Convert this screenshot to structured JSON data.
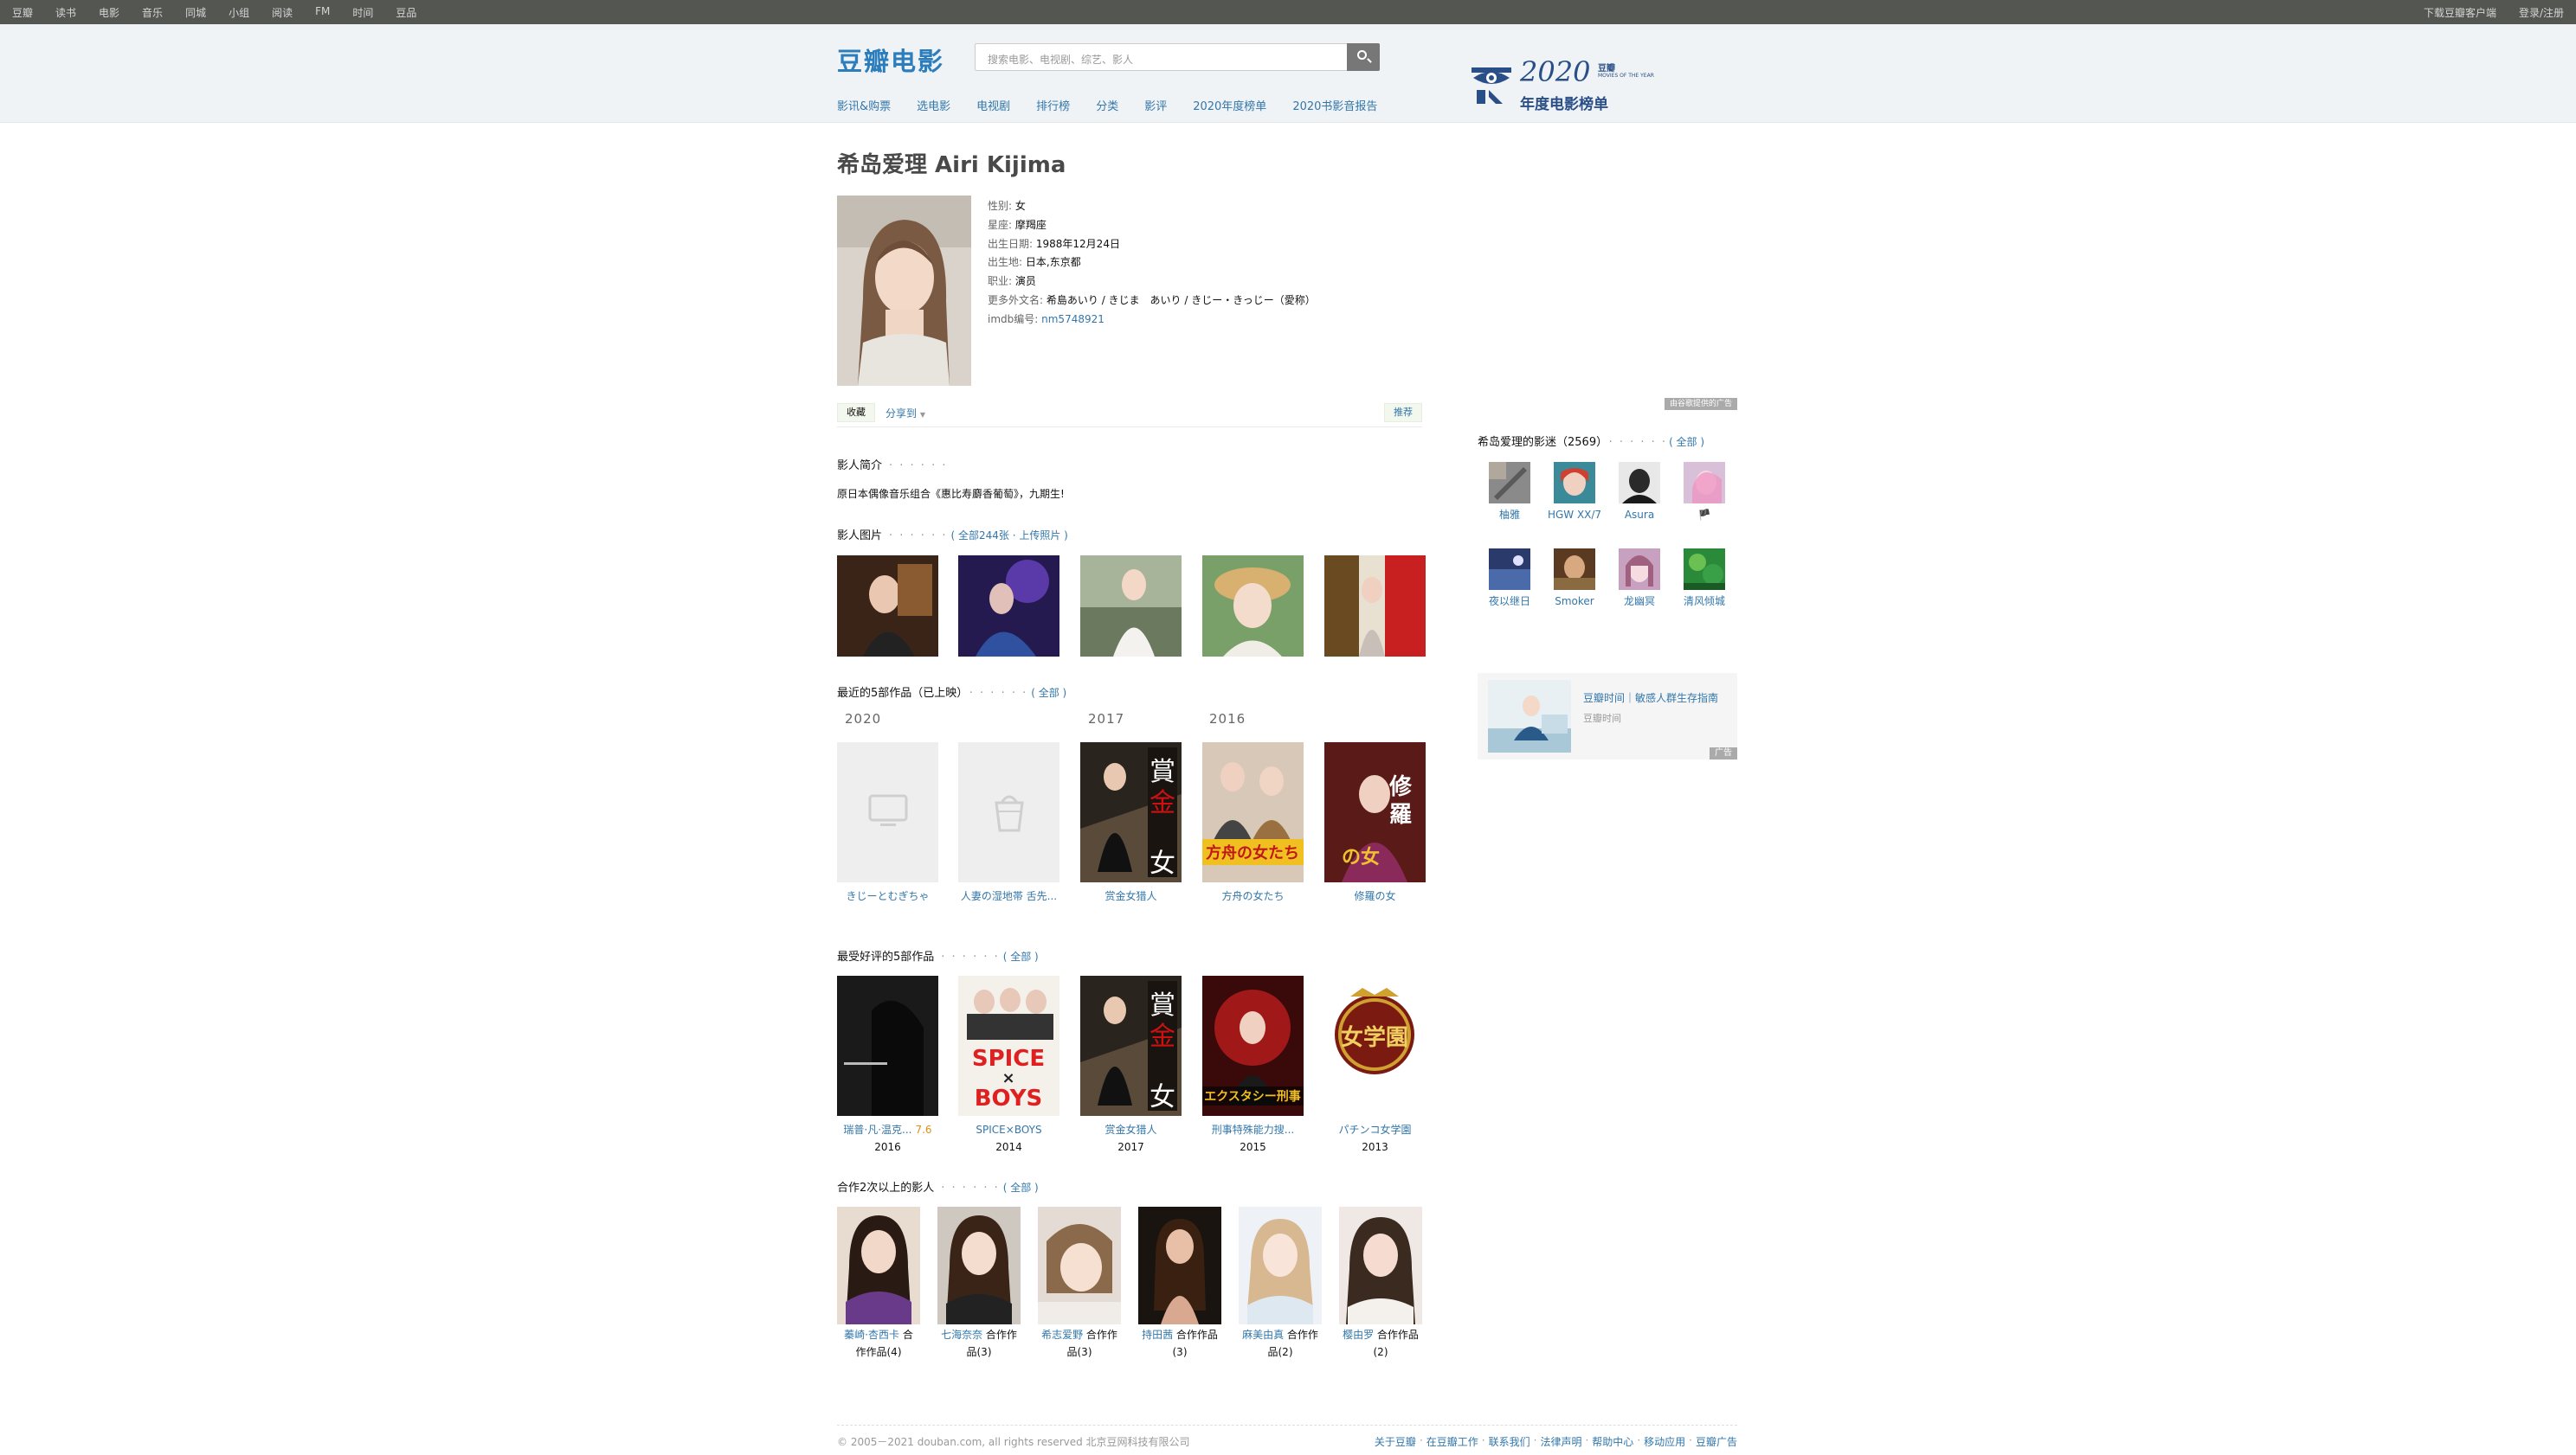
{
  "topnav": {
    "left": [
      "豆瓣",
      "读书",
      "电影",
      "音乐",
      "同城",
      "小组",
      "阅读",
      "FM",
      "时间",
      "豆品"
    ],
    "right": [
      "下载豆瓣客户端",
      "登录/注册"
    ]
  },
  "header": {
    "logo": "豆瓣电影",
    "search_placeholder": "搜索电影、电视剧、综艺、影人",
    "menu": [
      "影讯&购票",
      "选电影",
      "电视剧",
      "排行榜",
      "分类",
      "影评",
      "2020年度榜单",
      "2020书影音报告"
    ],
    "year_logo": {
      "num": "2020",
      "brand": "豆瓣",
      "sub": "MOVIES OF THE YEAR",
      "tag": "年度电影榜单"
    }
  },
  "person": {
    "name": "希岛爱理 Airi Kijima",
    "info": [
      {
        "label": "性别:",
        "value": "女"
      },
      {
        "label": "星座:",
        "value": "摩羯座"
      },
      {
        "label": "出生日期:",
        "value": "1988年12月24日"
      },
      {
        "label": "出生地:",
        "value": "日本,东京都"
      },
      {
        "label": "职业:",
        "value": "演员"
      },
      {
        "label": "更多外文名:",
        "value": "希島あいり / きじま　あいり / きじー・きっじー（愛称）"
      },
      {
        "label": "imdb编号:",
        "value": "nm5748921",
        "link": true
      }
    ]
  },
  "actions": {
    "fav": "收藏",
    "share": "分享到",
    "share_arrow": "▼",
    "recommend": "推荐"
  },
  "sections": {
    "bio_title": "影人简介",
    "bio_dots": "· · · · · ·",
    "bio_text": "原日本偶像音乐组合《惠比寿麝香葡萄》，九期生!",
    "photos_title": "影人图片",
    "photos_dots": "· · · · · ·",
    "photos_paren": "( 全部244张 · 上传照片 )",
    "recent_title": "最近的5部作品（已上映）",
    "recent_dots": "· · · · · ·",
    "recent_paren": "( 全部 )",
    "best_title": "最受好评的5部作品",
    "best_dots": "· · · · · ·",
    "best_paren": "( 全部 )",
    "coll_title": "合作2次以上的影人",
    "coll_dots": "· · · · · ·",
    "coll_paren": "( 全部 )"
  },
  "recent_years": [
    "2020",
    "2017",
    "2016"
  ],
  "recent_works": [
    {
      "title": "きじーとむぎちゃ",
      "title2": ""
    },
    {
      "title": "人妻の湿地帯 舌先...",
      "title2": ""
    },
    {
      "title": "赏金女猎人",
      "title2": ""
    },
    {
      "title": "方舟の女たち",
      "title2": ""
    },
    {
      "title": "修羅の女",
      "title2": ""
    }
  ],
  "best_works": [
    {
      "title": "瑞普·凡·温克...",
      "rating": "7.6",
      "year": "2016"
    },
    {
      "title": "SPICE×BOYS",
      "rating": "",
      "year": "2014"
    },
    {
      "title": "赏金女猎人",
      "rating": "",
      "year": "2017"
    },
    {
      "title": "刑事特殊能力搜...",
      "rating": "",
      "year": "2015"
    },
    {
      "title": "パチンコ女学園",
      "rating": "",
      "year": "2013"
    }
  ],
  "collaborators": [
    {
      "name": "蓁崎·杏西卡",
      "rest": "合",
      "line2": "作作品(4)"
    },
    {
      "name": "七海奈奈",
      "rest": "合作作",
      "line2": "品(3)"
    },
    {
      "name": "希志爱野",
      "rest": "合作作",
      "line2": "品(3)"
    },
    {
      "name": "持田茜",
      "rest": "合作作品",
      "line2": "(3)"
    },
    {
      "name": "麻美由真",
      "rest": "合作作",
      "line2": "品(2)"
    },
    {
      "name": "樱由罗",
      "rest": "合作作品",
      "line2": "(2)"
    }
  ],
  "sidebar": {
    "ad_label": "由谷歌提供的广告",
    "fans_title": "希岛爱理的影迷（2569）",
    "fans_dots": "· · · · · ·",
    "fans_paren": "( 全部 )",
    "fans": [
      "柚雅",
      "HGW XX/7",
      "Asura",
      "🏴",
      "夜以继日",
      "Smoker",
      "龙幽冥",
      "清风倾城"
    ],
    "ad_title": "豆瓣时间｜敏感人群生存指南",
    "ad_source": "豆瓣时间",
    "ad_tag": "广告"
  },
  "footer": {
    "copyright": "© 2005－2021 douban.com, all rights reserved 北京豆网科技有限公司",
    "links": [
      "关于豆瓣",
      "在豆瓣工作",
      "联系我们",
      "法律声明",
      "帮助中心",
      "移动应用",
      "豆瓣广告"
    ]
  },
  "colors": {
    "link": "#3377aa",
    "topbar": "#545652",
    "header_bg": "#f0f3f5",
    "logo": "#2b7dbc",
    "rating": "#e09015"
  }
}
